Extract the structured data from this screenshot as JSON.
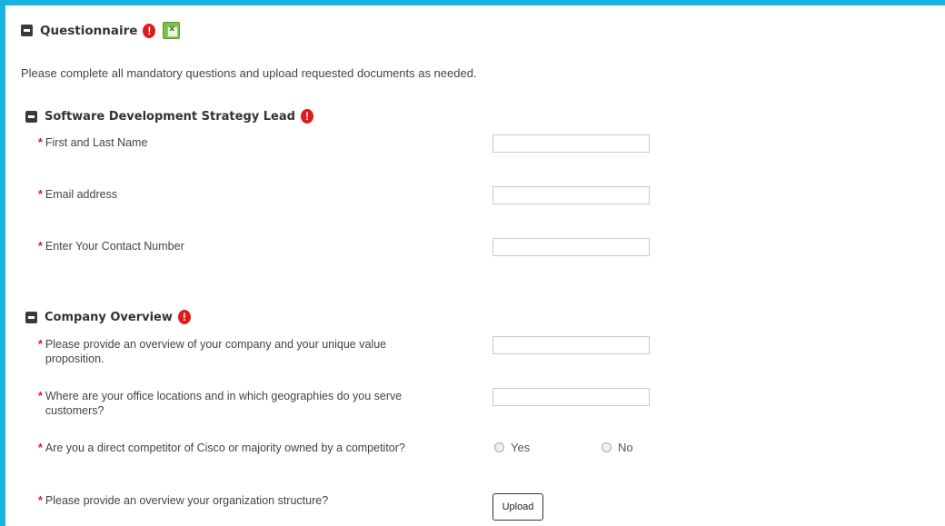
{
  "questionnaire": {
    "title": "Questionnaire",
    "intro": "Please complete all mandatory questions and upload requested documents as needed."
  },
  "sections": [
    {
      "title": "Software Development Strategy Lead",
      "questions": [
        {
          "label": "First and Last Name",
          "value": ""
        },
        {
          "label": "Email address",
          "value": ""
        },
        {
          "label": "Enter Your Contact Number",
          "value": ""
        }
      ]
    },
    {
      "title": "Company Overview",
      "questions": [
        {
          "label_line1": "Please provide an overview of your company and your unique value",
          "label_line2": "proposition.",
          "value": ""
        },
        {
          "label_line1": "Where are your office locations and in which geographies do you serve",
          "label_line2": "customers?",
          "value": ""
        },
        {
          "label": "Are you a direct competitor of Cisco or majority owned by a competitor?",
          "options": [
            "Yes",
            "No"
          ]
        },
        {
          "label": "Please provide an overview your organization structure?",
          "button": "Upload"
        }
      ]
    }
  ],
  "required_marker": "*",
  "alert_glyph": "!",
  "colors": {
    "frame": "#18b4e0",
    "required": "#e0191b",
    "alert": "#e0191b"
  }
}
